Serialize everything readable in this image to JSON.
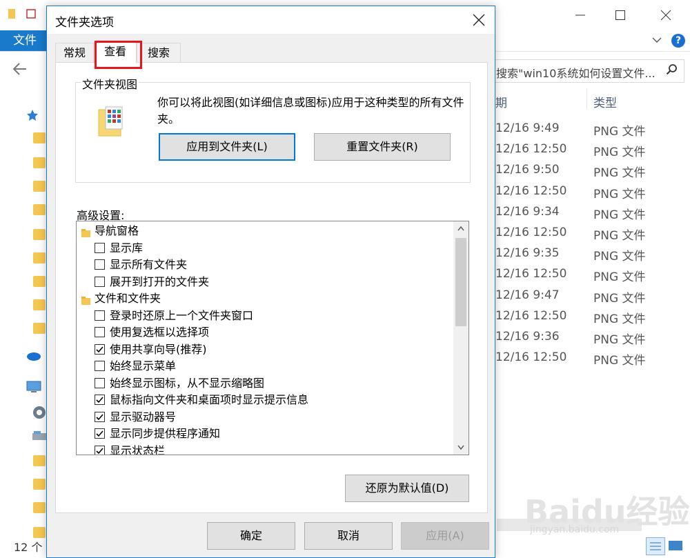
{
  "explorer": {
    "ribbon_file_tab": "文件",
    "search_text": "搜索\"win10系统如何设置文件...",
    "col_date": "期",
    "col_type": "类型",
    "dates": [
      "12/16 9:49",
      "12/16 12:50",
      "12/16 9:50",
      "12/16 12:50",
      "12/16 9:34",
      "12/16 12:50",
      "12/16 9:35",
      "12/16 12:50",
      "12/16 9:47",
      "12/16 12:50",
      "12/16 9:36",
      "12/16 12:50"
    ],
    "types": [
      "PNG 文件",
      "PNG 文件",
      "PNG 文件",
      "PNG 文件",
      "PNG 文件",
      "PNG 文件",
      "PNG 文件",
      "PNG 文件",
      "PNG 文件",
      "PNG 文件",
      "PNG 文件",
      "PNG 文件"
    ],
    "status": "12 个",
    "watermark": "Baidu经验",
    "watermark_url": "jingyan.baidu.com"
  },
  "dialog": {
    "title": "文件夹选项",
    "tabs": [
      "常规",
      "查看",
      "搜索"
    ],
    "active_tab": "查看",
    "folder_views": {
      "group_title": "文件夹视图",
      "description": "你可以将此视图(如详细信息或图标)应用于这种类型的所有文件夹。",
      "apply_button": "应用到文件夹(L)",
      "reset_button": "重置文件夹(R)"
    },
    "advanced": {
      "label": "高级设置:",
      "items": [
        {
          "type": "group",
          "text": "导航窗格"
        },
        {
          "type": "check",
          "text": "显示库",
          "checked": false
        },
        {
          "type": "check",
          "text": "显示所有文件夹",
          "checked": false
        },
        {
          "type": "check",
          "text": "展开到打开的文件夹",
          "checked": false
        },
        {
          "type": "group",
          "text": "文件和文件夹"
        },
        {
          "type": "check",
          "text": "登录时还原上一个文件夹窗口",
          "checked": false
        },
        {
          "type": "check",
          "text": "使用复选框以选择项",
          "checked": false
        },
        {
          "type": "check",
          "text": "使用共享向导(推荐)",
          "checked": true
        },
        {
          "type": "check",
          "text": "始终显示菜单",
          "checked": false
        },
        {
          "type": "check",
          "text": "始终显示图标，从不显示缩略图",
          "checked": false
        },
        {
          "type": "check",
          "text": "鼠标指向文件夹和桌面项时显示提示信息",
          "checked": true
        },
        {
          "type": "check",
          "text": "显示驱动器号",
          "checked": true
        },
        {
          "type": "check",
          "text": "显示同步提供程序通知",
          "checked": true
        },
        {
          "type": "check",
          "text": "显示状态栏",
          "checked": true
        }
      ],
      "restore_button": "还原为默认值(D)"
    },
    "ok_button": "确定",
    "cancel_button": "取消",
    "apply_button": "应用(A)"
  },
  "colors": {
    "accent": "#1979ca",
    "highlight": "#e8151b"
  }
}
